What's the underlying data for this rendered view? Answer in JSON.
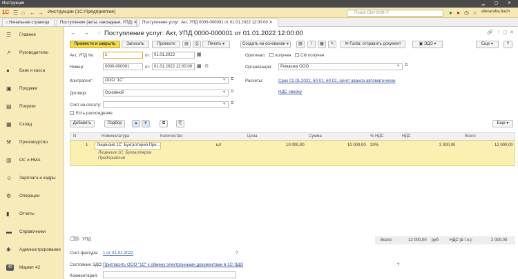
{
  "window": {
    "title": "Инструкции"
  },
  "appbar": {
    "logo": "1С",
    "title": "Инструкции (1С:Предприятие)",
    "search_placeholder": "Поиск Ctrl+Shift+F",
    "user": "alexandra.bach"
  },
  "tabs": [
    {
      "label": "Начальная страница"
    },
    {
      "label": "Поступление (акты, накладные, УПД)"
    },
    {
      "label": "Поступление услуг: Акт, УПД 0000-000001 от 01.01.2022 12:00:00"
    }
  ],
  "sidebar": {
    "items": [
      {
        "label": "Главное",
        "icon": "☰"
      },
      {
        "label": "Руководителю",
        "icon": "↗"
      },
      {
        "label": "Банк и касса",
        "icon": "●"
      },
      {
        "label": "Продажи",
        "icon": "▣"
      },
      {
        "label": "Покупки",
        "icon": "▤"
      },
      {
        "label": "Склад",
        "icon": "▦"
      },
      {
        "label": "Производство",
        "icon": "⚒"
      },
      {
        "label": "ОС и НМА",
        "icon": "▥"
      },
      {
        "label": "Зарплата и кадры",
        "icon": "☺"
      },
      {
        "label": "Операции",
        "icon": "⚙"
      },
      {
        "label": "Отчеты",
        "icon": "▮"
      },
      {
        "label": "Справочники",
        "icon": "▬"
      },
      {
        "label": "Администрирование",
        "icon": "✱"
      },
      {
        "label": "Маркет 42",
        "icon": "42"
      }
    ]
  },
  "document": {
    "title": "Поступление услуг: Акт, УПД 0000-000001 от 01.01.2022 12:00:00",
    "toolbar": {
      "post_close": "Провести и закрыть",
      "save": "Записать",
      "post": "Провести",
      "print": "Печать",
      "create_based": "Создать на основании",
      "fasta": "Fasta: отправить документ",
      "edo": "ЭДО",
      "more": "Еще"
    },
    "fields": {
      "act_label": "Акт, УПД №:",
      "act_value": "1",
      "from1": "от:",
      "date1": "01.01.2022",
      "number_label": "Номер:",
      "number_value": "0000-000001",
      "from2": "от:",
      "date2": "01.01.2022 12:00:00",
      "original_label": "Оригинал:",
      "received": "получен",
      "sf_received": "СФ получен",
      "org_label": "Организация:",
      "org_value": "Ромашка ООО",
      "contractor_label": "Контрагент:",
      "contractor_value": "ООО \"1С\"",
      "settlements_label": "Расчеты:",
      "settlements_link": "Срок 01.01.2022, 60.01, 60.02, зачет аванса автоматически",
      "vat_link": "НДС сверху",
      "contract_label": "Договор:",
      "contract_value": "Основной",
      "invoice_label": "Счет на оплату:",
      "discrepancy": "Есть расхождение"
    },
    "table": {
      "add": "Добавить",
      "select": "Подбор",
      "more": "Еще",
      "columns": [
        "N",
        "Номенклатура",
        "Количество",
        "Цена",
        "Сумма",
        "% НДС",
        "НДС",
        "Всего"
      ],
      "rows": [
        {
          "n": "1",
          "name": "Лицензия 1С: Бухгалтерия Пре...",
          "desc1": "Лицензия 1С: Бухгалтерия",
          "desc2": "Предприятия",
          "unit": "шт",
          "price": "10 000,00",
          "sum": "10 000,00",
          "vat_rate": "20%",
          "vat": "2 000,00",
          "total": "12 000,00"
        }
      ]
    },
    "footer": {
      "upd_toggle": "УПД",
      "total_label": "Всего:",
      "total_value": "12 000,00",
      "currency": "руб",
      "vat_label": "НДС (в т.ч.):",
      "vat_value": "2 000,00",
      "invoice_label": "Счет-фактура:",
      "invoice_link": "1 от 01.01.2022",
      "help": "?",
      "edo_label": "Состояние ЭДО:",
      "edo_link": "Пригласить ООО \"1С\" к обмену электронными документами в 1С-ЭДО",
      "comment_label": "Комментарий:"
    }
  }
}
